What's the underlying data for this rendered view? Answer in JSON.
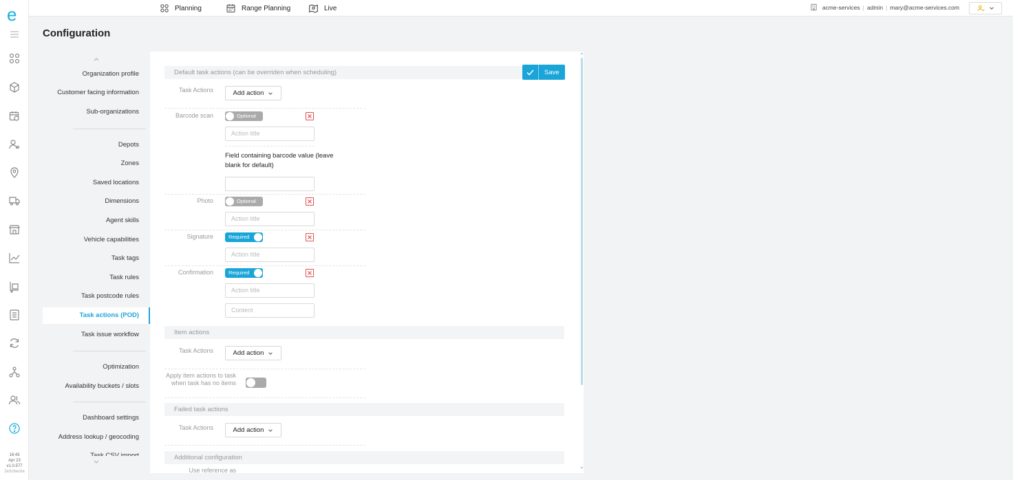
{
  "app": {
    "logo": "e",
    "version_lines": [
      "16:43",
      "Apr 23",
      "v1.0.577",
      "2e3c6ec8a"
    ]
  },
  "topnav": [
    {
      "label": "Planning",
      "icon": "planning-icon"
    },
    {
      "label": "Range Planning",
      "icon": "calendar-icon"
    },
    {
      "label": "Live",
      "icon": "map-pin-icon"
    }
  ],
  "user": {
    "org": "acme-services",
    "role": "admin",
    "email": "mary@acme-services.com"
  },
  "page": {
    "title": "Configuration"
  },
  "menu": {
    "items": [
      "Organization profile",
      "Customer facing information",
      "Sub-organizations",
      "Depots",
      "Zones",
      "Saved locations",
      "Dimensions",
      "Agent skills",
      "Vehicle capabilities",
      "Task tags",
      "Task rules",
      "Task postcode rules",
      "Task actions (POD)",
      "Task issue workflow",
      "Optimization",
      "Availability buckets / slots",
      "Dashboard settings",
      "Address lookup / geocoding",
      "Task CSV import"
    ],
    "active": "Task actions (POD)"
  },
  "content": {
    "save_label": "Save",
    "default_section": "Default task actions (can be overriden when scheduling)",
    "task_actions_label": "Task Actions",
    "add_action_label": "Add action",
    "barcode_label": "Barcode scan",
    "photo_label": "Photo",
    "signature_label": "Signature",
    "confirmation_label": "Confirmation",
    "optional_label": "Optional",
    "required_label": "Required",
    "action_title_placeholder": "Action title",
    "content_placeholder": "Content",
    "barcode_field_label": "Field containing barcode value (leave blank for default)",
    "item_section": "Item actions",
    "apply_item_label": "Apply item actions to task when task has no items",
    "failed_section": "Failed task actions",
    "additional_section": "Additional configuration",
    "use_reference_label": "Use reference as"
  },
  "colors": {
    "accent": "#1aa5d8",
    "danger": "#e05050"
  }
}
